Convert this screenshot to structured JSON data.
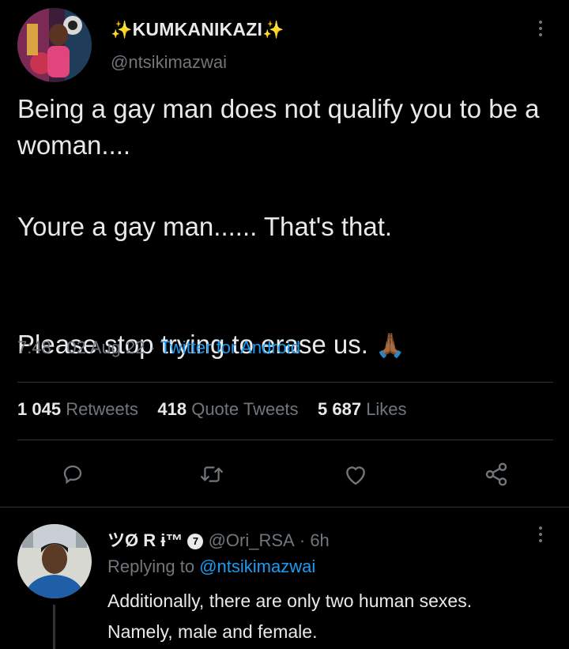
{
  "tweet": {
    "display_name": "KUMKANIKAZI",
    "sparkle_left": "✨",
    "sparkle_right": "✨",
    "handle": "@ntsikimazwai",
    "text_lines": [
      "Being a gay man does not qualify you to be a woman....",
      "Youre a gay man...... That's that.",
      "Please stop trying to erase us. "
    ],
    "emoji": "🙏🏾",
    "time": "7:48",
    "date": "02 Aug 22",
    "source": "Twitter for Android",
    "sep": "·"
  },
  "stats": {
    "retweets_count": "1 045",
    "retweets_label": "Retweets",
    "quotes_count": "418",
    "quotes_label": "Quote Tweets",
    "likes_count": "5 687",
    "likes_label": "Likes"
  },
  "actions": [
    "reply-icon",
    "retweet-icon",
    "like-icon",
    "share-icon"
  ],
  "reply": {
    "display_name": "ツØ R ɨ™",
    "badge": "7",
    "handle": "@Ori_RSA",
    "sep": "·",
    "age": "6h",
    "replying_label": "Replying to",
    "replying_handle": "@ntsikimazwai",
    "text": "Additionally, there are only two human sexes. Namely, male and female."
  },
  "colors": {
    "background": "#000000",
    "text": "#e7e9ea",
    "secondary": "#71767b",
    "link": "#1d9bf0",
    "divider": "#2f3336"
  }
}
